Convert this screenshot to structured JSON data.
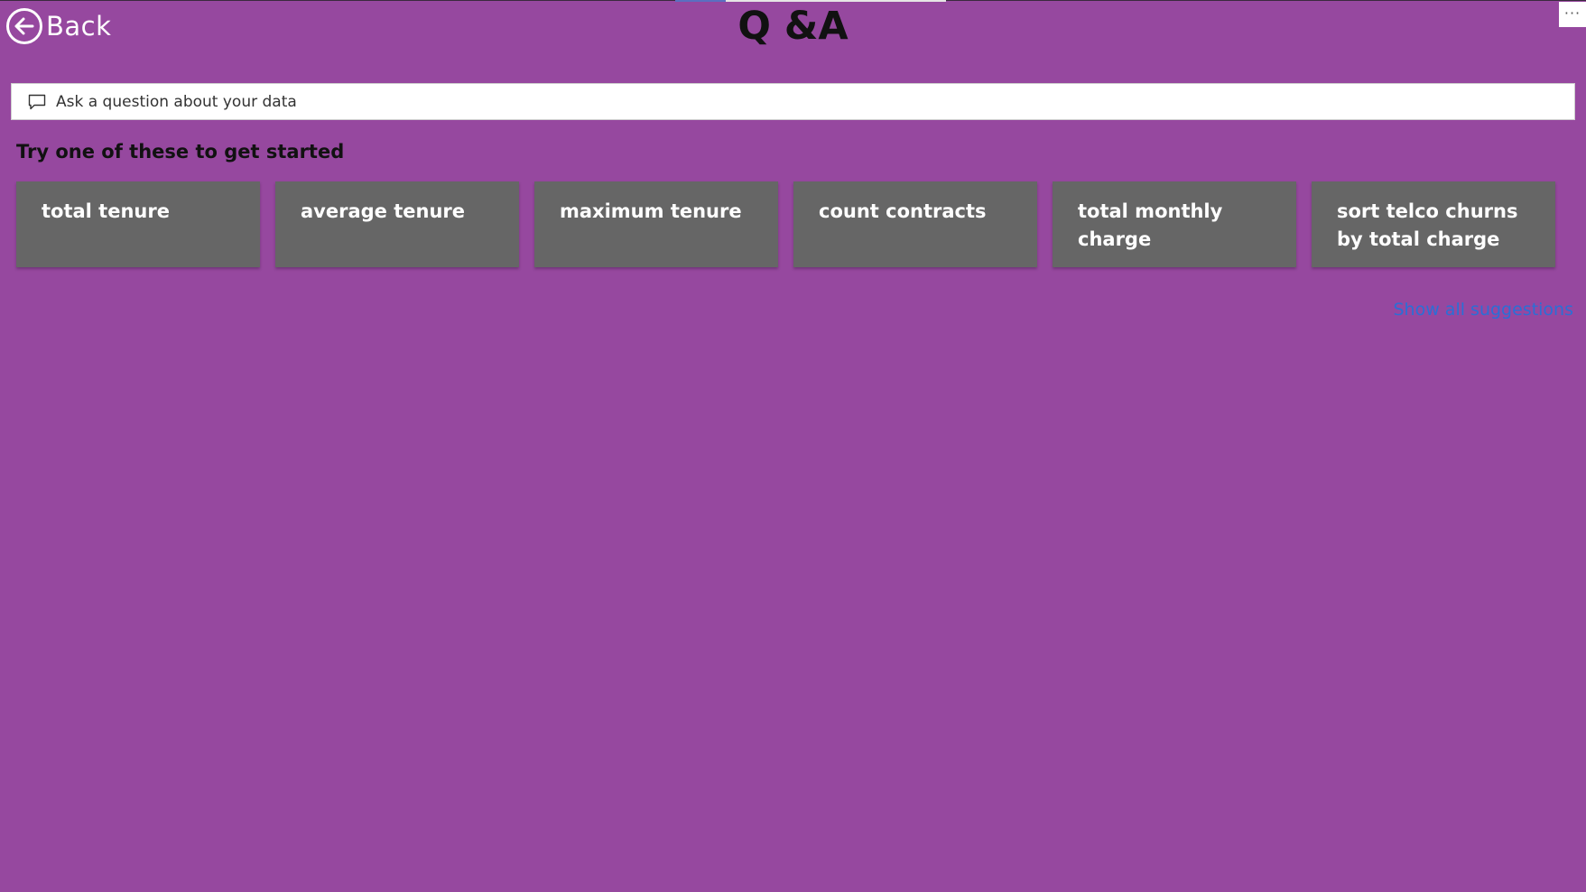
{
  "header": {
    "back_label": "Back",
    "title": "Q &A",
    "more_label": "···"
  },
  "search": {
    "placeholder": "Ask a question about your data"
  },
  "suggestions": {
    "heading": "Try one of these to get started",
    "items": [
      {
        "label": "total tenure"
      },
      {
        "label": "average tenure"
      },
      {
        "label": "maximum tenure"
      },
      {
        "label": "count contracts"
      },
      {
        "label": "total monthly charge"
      },
      {
        "label": "sort telco churns by total charge"
      }
    ],
    "show_all_label": "Show all suggestions"
  },
  "colors": {
    "background": "#96489f",
    "card": "#666666",
    "link": "#2a6fd6",
    "title": "#111111"
  },
  "icons": {
    "back": "arrow-left-circle-icon",
    "search": "speech-bubble-icon",
    "more": "ellipsis-icon"
  }
}
